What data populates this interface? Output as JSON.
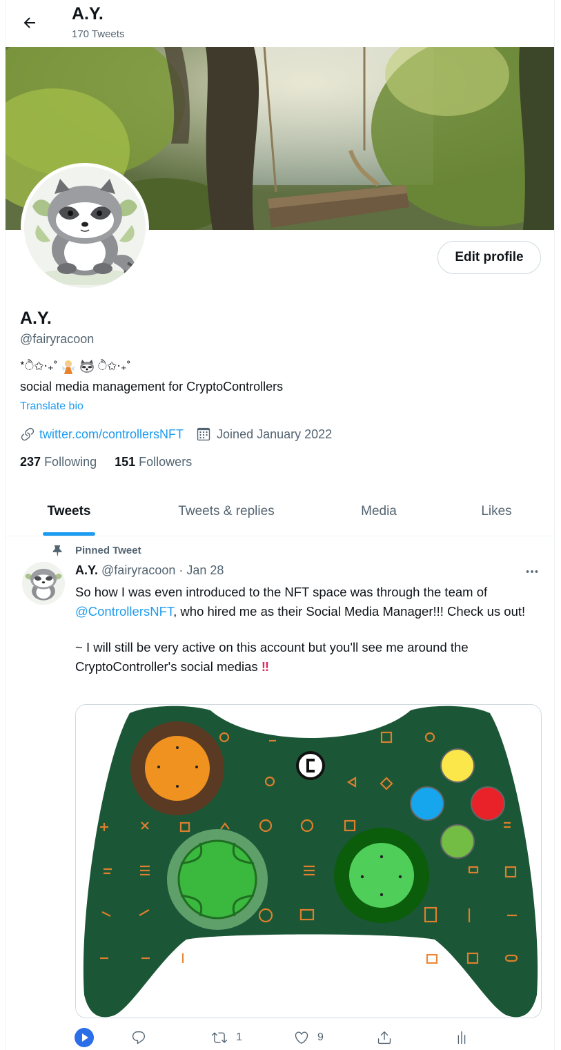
{
  "header": {
    "name": "A.Y.",
    "tweet_count": "170 Tweets"
  },
  "profile": {
    "edit_label": "Edit profile",
    "name": "A.Y.",
    "handle": "@fairyracoon",
    "bio_deco_left": "*ੈ✩‧₊˚",
    "bio_deco_right": "ੈ✩‧₊˚",
    "bio": "social media management for CryptoControllers",
    "translate": "Translate bio",
    "website": "twitter.com/controllersNFT",
    "joined": "Joined January 2022",
    "following_count": "237",
    "following_label": "Following",
    "followers_count": "151",
    "followers_label": "Followers"
  },
  "tabs": [
    {
      "label": "Tweets",
      "active": true
    },
    {
      "label": "Tweets & replies",
      "active": false
    },
    {
      "label": "Media",
      "active": false
    },
    {
      "label": "Likes",
      "active": false
    }
  ],
  "tweet": {
    "pinned_label": "Pinned Tweet",
    "author": "A.Y.",
    "handle": "@fairyracoon",
    "date": "· Jan 28",
    "text_1": "So how I was even introduced to the NFT space was through the team of",
    "mention": "@ControllersNFT",
    "text_2": ", who hired me as their Social Media Manager!!! Check us out!",
    "text_3": "~ I will still be very active on this account but you'll see me around the CryptoController's social medias",
    "emphasis": "‼",
    "replies": "",
    "retweets": "1",
    "likes": "9"
  },
  "colors": {
    "accent": "#1d9bf0",
    "controller_green": "#1b5736",
    "icon_orange": "#e9822d",
    "button_yellow": "#fbe74a",
    "button_blue": "#16a6ee",
    "button_red": "#e9222a",
    "button_green": "#73bd44"
  },
  "icons": [
    "back-arrow-icon",
    "link-icon",
    "calendar-icon",
    "pin-icon",
    "more-icon",
    "play-icon",
    "reply-icon",
    "retweet-icon",
    "like-icon",
    "share-icon",
    "analytics-icon"
  ]
}
